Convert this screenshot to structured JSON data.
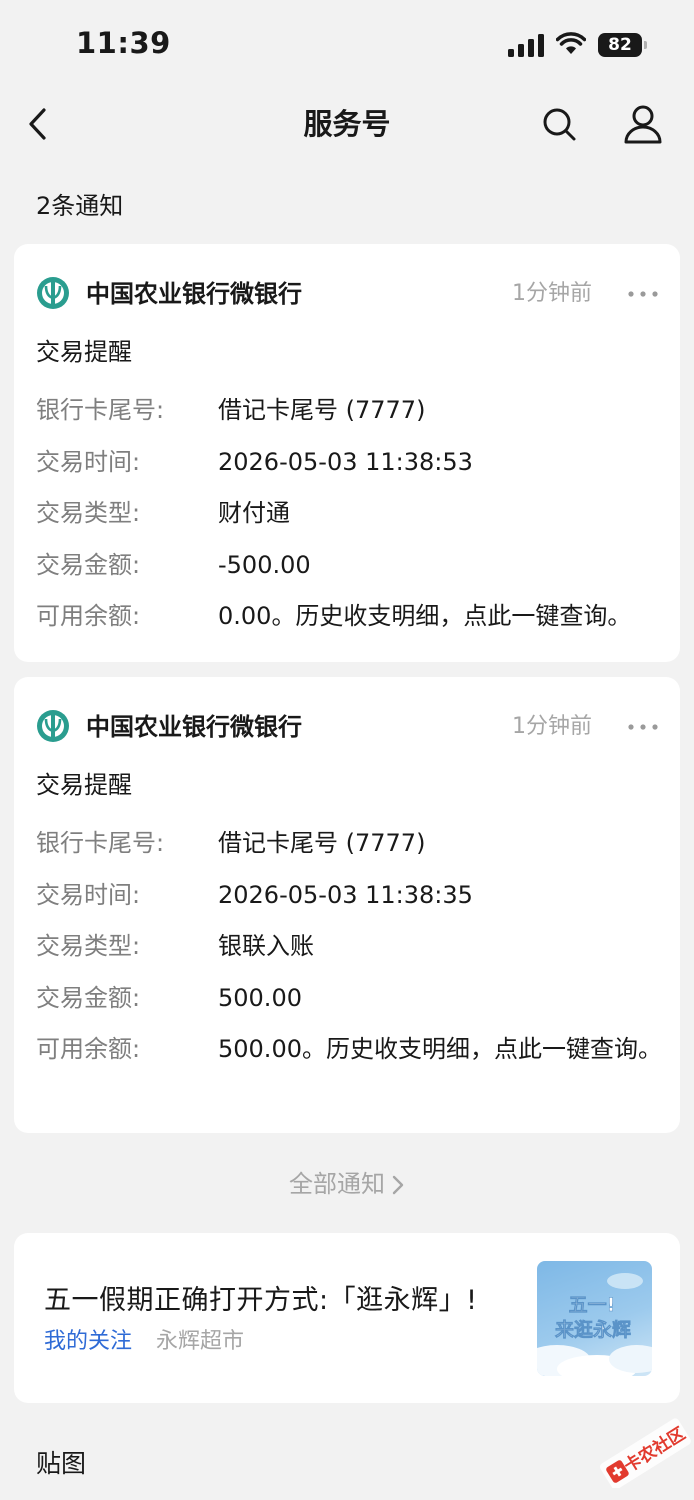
{
  "status_bar": {
    "time": "11:39",
    "battery": "82"
  },
  "nav": {
    "title": "服务号"
  },
  "notice_count": "2条通知",
  "notifications": [
    {
      "account": "中国农业银行微银行",
      "time": "1分钟前",
      "subject": "交易提醒",
      "rows": [
        {
          "label": "银行卡尾号:",
          "value": "借记卡尾号 (7777)"
        },
        {
          "label": "交易时间:",
          "value": "2026-05-03 11:38:53"
        },
        {
          "label": "交易类型:",
          "value": "财付通"
        },
        {
          "label": "交易金额:",
          "value": "-500.00"
        },
        {
          "label": "可用余额:",
          "value": "0.00。历史收支明细，点此一键查询。"
        }
      ]
    },
    {
      "account": "中国农业银行微银行",
      "time": "1分钟前",
      "subject": "交易提醒",
      "rows": [
        {
          "label": "银行卡尾号:",
          "value": "借记卡尾号 (7777)"
        },
        {
          "label": "交易时间:",
          "value": "2026-05-03 11:38:35"
        },
        {
          "label": "交易类型:",
          "value": "银联入账"
        },
        {
          "label": "交易金额:",
          "value": "500.00"
        },
        {
          "label": "可用余额:",
          "value": "500.00。历史收支明细，点此一键查询。"
        }
      ]
    }
  ],
  "all_notices": "全部通知",
  "recommendation": {
    "title": "五一假期正确打开方式:「逛永辉」!",
    "source": "我的关注",
    "account": "永辉超市",
    "thumbnail_text_1": "五一!",
    "thumbnail_text_2": "来逛永辉"
  },
  "section_label": "贴图",
  "watermark_text": "卡农社区",
  "colors": {
    "bank_logo": "#2a9d8f",
    "link_blue": "#2f6bd6",
    "muted": "#a6a6a6"
  }
}
